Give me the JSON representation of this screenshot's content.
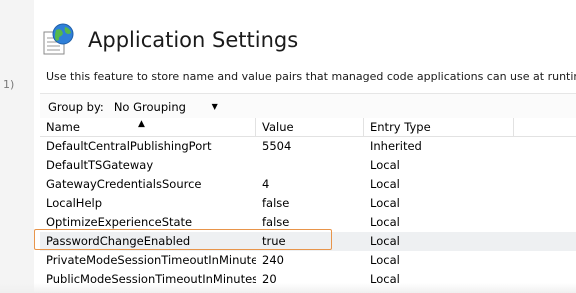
{
  "sidebar": {
    "fragment": "1)"
  },
  "header": {
    "title": "Application Settings"
  },
  "description": "Use this feature to store name and value pairs that managed code applications can use at runtime.",
  "toolbar": {
    "group_by_label": "Group by:",
    "group_by_value": "No Grouping"
  },
  "grid": {
    "columns": [
      "Name",
      "Value",
      "Entry Type"
    ],
    "rows": [
      {
        "name": "DefaultCentralPublishingPort",
        "value": "5504",
        "type": "Inherited"
      },
      {
        "name": "DefaultTSGateway",
        "value": "",
        "type": "Local"
      },
      {
        "name": "GatewayCredentialsSource",
        "value": "4",
        "type": "Local"
      },
      {
        "name": "LocalHelp",
        "value": "false",
        "type": "Local"
      },
      {
        "name": "OptimizeExperienceState",
        "value": "false",
        "type": "Local"
      },
      {
        "name": "PasswordChangeEnabled",
        "value": "true",
        "type": "Local"
      },
      {
        "name": "PrivateModeSessionTimeoutInMinutes",
        "value": "240",
        "type": "Local"
      },
      {
        "name": "PublicModeSessionTimeoutInMinutes",
        "value": "20",
        "type": "Local"
      }
    ],
    "selected_row": 5
  },
  "icons": {
    "globe": "globe-icon",
    "sort": "sort-ascending-icon",
    "dropdown": "chevron-down-icon"
  },
  "colors": {
    "highlight": "#e8954b",
    "selected_row": "#eef0f2"
  }
}
